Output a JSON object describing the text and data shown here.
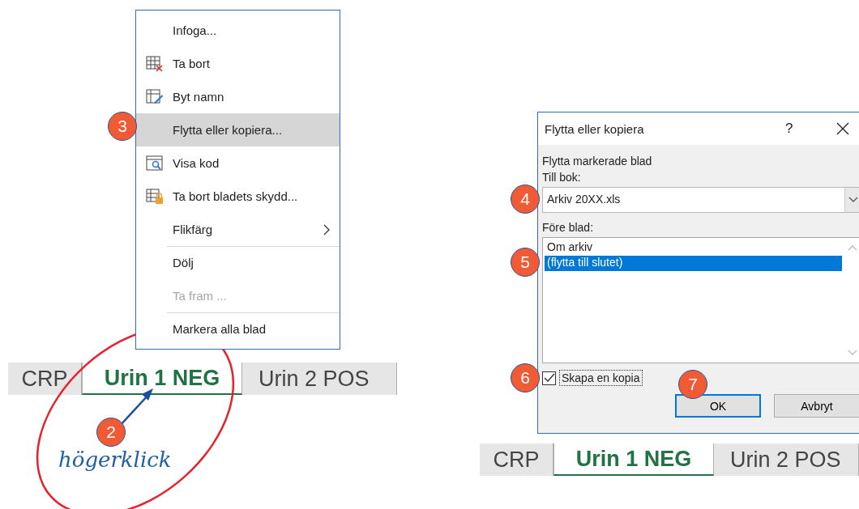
{
  "context_menu": {
    "items": [
      {
        "label": "Infoga...",
        "kind": "plain",
        "selected": false,
        "disabled": false,
        "submenu": false,
        "separator_before": false
      },
      {
        "label": "Ta bort",
        "kind": "delete",
        "selected": false,
        "disabled": false,
        "submenu": false,
        "separator_before": false
      },
      {
        "label": "Byt namn",
        "kind": "rename",
        "selected": false,
        "disabled": false,
        "submenu": false,
        "separator_before": false
      },
      {
        "label": "Flytta eller kopiera...",
        "kind": "plain",
        "selected": true,
        "disabled": false,
        "submenu": false,
        "separator_before": false,
        "step": "3"
      },
      {
        "label": "Visa kod",
        "kind": "code",
        "selected": false,
        "disabled": false,
        "submenu": false,
        "separator_before": false
      },
      {
        "label": "Ta bort bladets skydd...",
        "kind": "unprotect",
        "selected": false,
        "disabled": false,
        "submenu": false,
        "separator_before": false
      },
      {
        "label": "Flikfärg",
        "kind": "plain",
        "selected": false,
        "disabled": false,
        "submenu": true,
        "separator_before": false
      },
      {
        "label": "Dölj",
        "kind": "plain",
        "selected": false,
        "disabled": false,
        "submenu": false,
        "separator_before": true
      },
      {
        "label": "Ta fram ...",
        "kind": "plain",
        "selected": false,
        "disabled": true,
        "submenu": false,
        "separator_before": false
      },
      {
        "label": "Markera alla blad",
        "kind": "plain",
        "selected": false,
        "disabled": false,
        "submenu": false,
        "separator_before": true
      }
    ]
  },
  "sheet_tabs_left": [
    {
      "label": "CRP",
      "selected": false
    },
    {
      "label": "Urin 1 NEG",
      "selected": true
    },
    {
      "label": "Urin 2 POS",
      "selected": false
    }
  ],
  "annotation": {
    "step": "2",
    "text": "högerklick"
  },
  "dialog": {
    "title": "Flytta eller kopiera",
    "help": "?",
    "heading": "Flytta markerade blad",
    "to_book_label": "Till bok:",
    "to_book_value": "Arkiv 20XX.xls",
    "to_book_step": "4",
    "before_sheet_label": "Före blad:",
    "list_step": "5",
    "sheets": [
      {
        "label": "Om arkiv",
        "selected": false
      },
      {
        "label": "(flytta till slutet)",
        "selected": true
      }
    ],
    "copy_checkbox": {
      "label": "Skapa en kopia",
      "checked": true,
      "step": "6"
    },
    "buttons": [
      {
        "label": "OK",
        "default": true,
        "step": "7"
      },
      {
        "label": "Avbryt",
        "default": false
      }
    ]
  },
  "sheet_tabs_right": [
    {
      "label": "CRP",
      "selected": false
    },
    {
      "label": "Urin 1 NEG",
      "selected": true
    },
    {
      "label": "Urin 2 POS",
      "selected": false
    }
  ]
}
